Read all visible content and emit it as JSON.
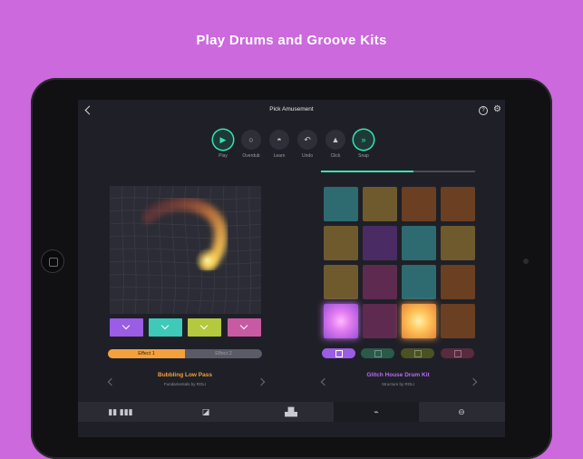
{
  "headline": "Play Drums and Groove Kits",
  "screen": {
    "title": "Pick Amusement",
    "help_icon_glyph": "?",
    "gear_icon_glyph": "⚙"
  },
  "toolbar": {
    "items": [
      {
        "label": "Play",
        "icon": "play-pause-icon",
        "glyph": "▶︎",
        "active": true
      },
      {
        "label": "Overdub",
        "icon": "record-icon",
        "glyph": "○",
        "active": false
      },
      {
        "label": "Learn",
        "icon": "graduation-cap-icon",
        "glyph": "◓",
        "active": false
      },
      {
        "label": "Undo",
        "icon": "undo-icon",
        "glyph": "↶",
        "active": false
      },
      {
        "label": "Click",
        "icon": "metronome-icon",
        "glyph": "▲",
        "active": false
      },
      {
        "label": "Snap",
        "icon": "snap-icon",
        "glyph": "»",
        "active": true
      }
    ],
    "progress": 0.6
  },
  "left_panel": {
    "effect_buttons": [
      {
        "color": "#9b5ce6"
      },
      {
        "color": "#3ec9b9"
      },
      {
        "color": "#b4c93d"
      },
      {
        "color": "#c85aa3"
      }
    ],
    "segments": [
      "Effect 1",
      "Effect 2"
    ],
    "selected_segment": 0,
    "patch_name": "Bubbling Low Pass",
    "patch_sub": "Fundamentals by ROLI",
    "patch_color": "#f3a13d"
  },
  "right_panel": {
    "pads": [
      "#2d6b70",
      "#6e5a2d",
      "#6a3f22",
      "#6a3f22",
      "#6e5a2d",
      "#4a2b63",
      "#2d6b70",
      "#6e5a2d",
      "#6e5a2d",
      "#5e2a50",
      "#2d6b70",
      "#6a3f22",
      "glow-violet",
      "#5e2a50",
      "glow-orange",
      "#6a3f22"
    ],
    "banks": [
      {
        "color": "#9b5ce6",
        "active": true
      },
      {
        "color": "#2a5a4a",
        "active": false
      },
      {
        "color": "#4a5222",
        "active": false
      },
      {
        "color": "#5a2a3f",
        "active": false
      }
    ],
    "kit_name": "Glitch House Drum Kit",
    "kit_sub": "Structure by ROLI",
    "kit_color": "#b56cf0"
  },
  "tabs": [
    {
      "icon": "keyboard-icon",
      "glyph": "▮▮ ▮▮▮",
      "active": false
    },
    {
      "icon": "pad-grid-icon",
      "glyph": "◪",
      "active": false
    },
    {
      "icon": "mixer-icon",
      "glyph": "▟▙",
      "active": false
    },
    {
      "icon": "wave-icon",
      "glyph": "⌁",
      "active": true
    },
    {
      "icon": "sequencer-icon",
      "glyph": "⊖",
      "active": false
    }
  ],
  "colors": {
    "background": "#cb69dd",
    "accent": "#37e3b4",
    "screen": "#1f2027"
  }
}
